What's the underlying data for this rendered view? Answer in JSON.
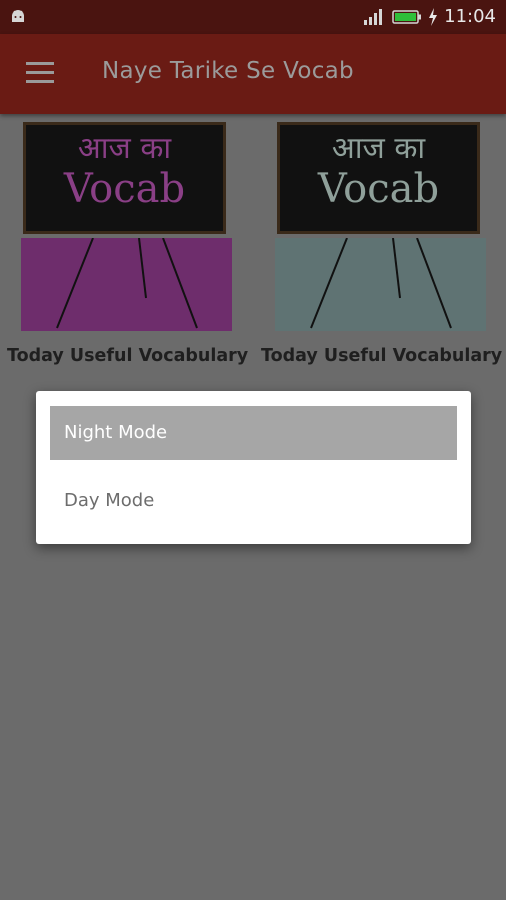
{
  "status_bar": {
    "time": "11:04",
    "icons": [
      "android-icon",
      "signal-icon",
      "battery-icon",
      "charging-icon"
    ]
  },
  "app_bar": {
    "title": "Naye Tarike Se Vocab",
    "menu_icon": "hamburger-menu-icon"
  },
  "cards": [
    {
      "board_hindi": "आज का",
      "board_english": "Vocab",
      "caption": "Today Useful Vocabulary",
      "text_color": "#8a3f86",
      "lower_color": "#6e2d6c"
    },
    {
      "board_hindi": "आज का",
      "board_english": "Vocab",
      "caption": "Today Useful Vocabulary",
      "text_color": "#8fa09a",
      "lower_color": "#5f7373"
    }
  ],
  "dialog": {
    "options": [
      {
        "label": "Night Mode",
        "selected": true
      },
      {
        "label": "Day Mode",
        "selected": false
      }
    ]
  },
  "colors": {
    "status_bar": "#4a1410",
    "app_bar": "#6a1b14",
    "scrim": "#6b6b6b",
    "selected_option": "#a6a6a6"
  }
}
